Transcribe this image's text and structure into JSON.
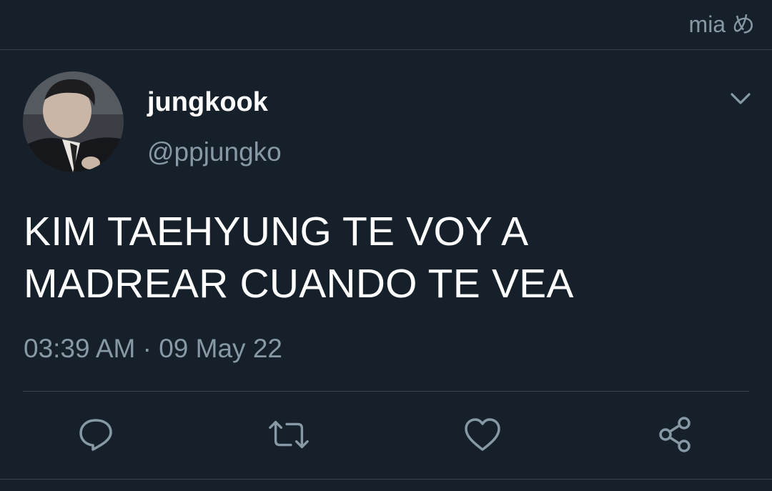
{
  "topbar": {
    "label": "mia め"
  },
  "tweet": {
    "display_name": "jungkook",
    "handle": "@ppjungko",
    "text_lines": [
      "KIM TAEHYUNG TE VOY A",
      "MADREAR CUANDO TE VEA"
    ],
    "timestamp": "03:39 AM · 09 May 22"
  },
  "actions": [
    {
      "icon": "reply-icon"
    },
    {
      "icon": "retweet-icon"
    },
    {
      "icon": "like-icon"
    },
    {
      "icon": "share-icon"
    }
  ],
  "colors": {
    "background": "#15202b",
    "secondary_text": "#8899a6",
    "divider": "#38444d",
    "primary_text": "#ffffff"
  }
}
